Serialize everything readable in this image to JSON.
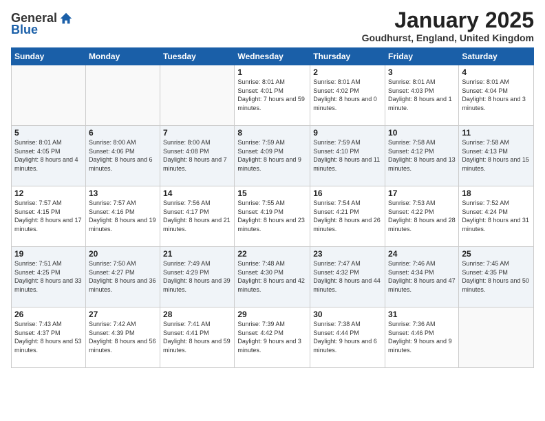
{
  "logo": {
    "general": "General",
    "blue": "Blue"
  },
  "title": "January 2025",
  "location": "Goudhurst, England, United Kingdom",
  "days_header": [
    "Sunday",
    "Monday",
    "Tuesday",
    "Wednesday",
    "Thursday",
    "Friday",
    "Saturday"
  ],
  "weeks": [
    [
      {
        "day": "",
        "info": ""
      },
      {
        "day": "",
        "info": ""
      },
      {
        "day": "",
        "info": ""
      },
      {
        "day": "1",
        "info": "Sunrise: 8:01 AM\nSunset: 4:01 PM\nDaylight: 7 hours\nand 59 minutes."
      },
      {
        "day": "2",
        "info": "Sunrise: 8:01 AM\nSunset: 4:02 PM\nDaylight: 8 hours\nand 0 minutes."
      },
      {
        "day": "3",
        "info": "Sunrise: 8:01 AM\nSunset: 4:03 PM\nDaylight: 8 hours\nand 1 minute."
      },
      {
        "day": "4",
        "info": "Sunrise: 8:01 AM\nSunset: 4:04 PM\nDaylight: 8 hours\nand 3 minutes."
      }
    ],
    [
      {
        "day": "5",
        "info": "Sunrise: 8:01 AM\nSunset: 4:05 PM\nDaylight: 8 hours\nand 4 minutes."
      },
      {
        "day": "6",
        "info": "Sunrise: 8:00 AM\nSunset: 4:06 PM\nDaylight: 8 hours\nand 6 minutes."
      },
      {
        "day": "7",
        "info": "Sunrise: 8:00 AM\nSunset: 4:08 PM\nDaylight: 8 hours\nand 7 minutes."
      },
      {
        "day": "8",
        "info": "Sunrise: 7:59 AM\nSunset: 4:09 PM\nDaylight: 8 hours\nand 9 minutes."
      },
      {
        "day": "9",
        "info": "Sunrise: 7:59 AM\nSunset: 4:10 PM\nDaylight: 8 hours\nand 11 minutes."
      },
      {
        "day": "10",
        "info": "Sunrise: 7:58 AM\nSunset: 4:12 PM\nDaylight: 8 hours\nand 13 minutes."
      },
      {
        "day": "11",
        "info": "Sunrise: 7:58 AM\nSunset: 4:13 PM\nDaylight: 8 hours\nand 15 minutes."
      }
    ],
    [
      {
        "day": "12",
        "info": "Sunrise: 7:57 AM\nSunset: 4:15 PM\nDaylight: 8 hours\nand 17 minutes."
      },
      {
        "day": "13",
        "info": "Sunrise: 7:57 AM\nSunset: 4:16 PM\nDaylight: 8 hours\nand 19 minutes."
      },
      {
        "day": "14",
        "info": "Sunrise: 7:56 AM\nSunset: 4:17 PM\nDaylight: 8 hours\nand 21 minutes."
      },
      {
        "day": "15",
        "info": "Sunrise: 7:55 AM\nSunset: 4:19 PM\nDaylight: 8 hours\nand 23 minutes."
      },
      {
        "day": "16",
        "info": "Sunrise: 7:54 AM\nSunset: 4:21 PM\nDaylight: 8 hours\nand 26 minutes."
      },
      {
        "day": "17",
        "info": "Sunrise: 7:53 AM\nSunset: 4:22 PM\nDaylight: 8 hours\nand 28 minutes."
      },
      {
        "day": "18",
        "info": "Sunrise: 7:52 AM\nSunset: 4:24 PM\nDaylight: 8 hours\nand 31 minutes."
      }
    ],
    [
      {
        "day": "19",
        "info": "Sunrise: 7:51 AM\nSunset: 4:25 PM\nDaylight: 8 hours\nand 33 minutes."
      },
      {
        "day": "20",
        "info": "Sunrise: 7:50 AM\nSunset: 4:27 PM\nDaylight: 8 hours\nand 36 minutes."
      },
      {
        "day": "21",
        "info": "Sunrise: 7:49 AM\nSunset: 4:29 PM\nDaylight: 8 hours\nand 39 minutes."
      },
      {
        "day": "22",
        "info": "Sunrise: 7:48 AM\nSunset: 4:30 PM\nDaylight: 8 hours\nand 42 minutes."
      },
      {
        "day": "23",
        "info": "Sunrise: 7:47 AM\nSunset: 4:32 PM\nDaylight: 8 hours\nand 44 minutes."
      },
      {
        "day": "24",
        "info": "Sunrise: 7:46 AM\nSunset: 4:34 PM\nDaylight: 8 hours\nand 47 minutes."
      },
      {
        "day": "25",
        "info": "Sunrise: 7:45 AM\nSunset: 4:35 PM\nDaylight: 8 hours\nand 50 minutes."
      }
    ],
    [
      {
        "day": "26",
        "info": "Sunrise: 7:43 AM\nSunset: 4:37 PM\nDaylight: 8 hours\nand 53 minutes."
      },
      {
        "day": "27",
        "info": "Sunrise: 7:42 AM\nSunset: 4:39 PM\nDaylight: 8 hours\nand 56 minutes."
      },
      {
        "day": "28",
        "info": "Sunrise: 7:41 AM\nSunset: 4:41 PM\nDaylight: 8 hours\nand 59 minutes."
      },
      {
        "day": "29",
        "info": "Sunrise: 7:39 AM\nSunset: 4:42 PM\nDaylight: 9 hours\nand 3 minutes."
      },
      {
        "day": "30",
        "info": "Sunrise: 7:38 AM\nSunset: 4:44 PM\nDaylight: 9 hours\nand 6 minutes."
      },
      {
        "day": "31",
        "info": "Sunrise: 7:36 AM\nSunset: 4:46 PM\nDaylight: 9 hours\nand 9 minutes."
      },
      {
        "day": "",
        "info": ""
      }
    ]
  ]
}
